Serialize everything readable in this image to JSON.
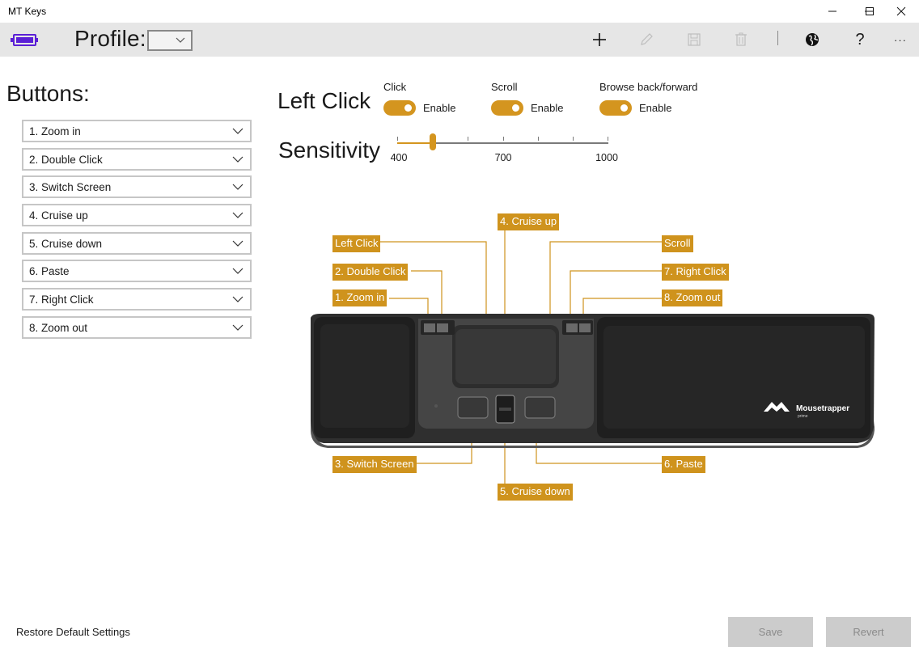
{
  "window": {
    "title": "MT Keys",
    "minimize_icon": "minimize-icon",
    "maximize_icon": "maximize-icon",
    "close_icon": "close-icon"
  },
  "toolbar": {
    "profile_label": "Profile:",
    "profile_value": "",
    "icons": [
      "add-icon",
      "edit-icon",
      "save-icon",
      "delete-icon",
      "globe-icon",
      "help-icon",
      "more-icon"
    ],
    "help_glyph": "?",
    "more_glyph": "···"
  },
  "colors": {
    "accent": "#d4951f",
    "callout": "#cf931d",
    "battery": "#5b1fd6"
  },
  "buttons_panel": {
    "heading": "Buttons:",
    "items": [
      {
        "label": "1. Zoom in"
      },
      {
        "label": "2. Double Click"
      },
      {
        "label": "3. Switch Screen"
      },
      {
        "label": "4. Cruise up"
      },
      {
        "label": "5. Cruise down"
      },
      {
        "label": "6. Paste"
      },
      {
        "label": "7. Right Click"
      },
      {
        "label": "8. Zoom out"
      }
    ]
  },
  "left_click": {
    "title": "Left Click",
    "toggles": [
      {
        "label": "Click",
        "state_text": "Enable",
        "on": true
      },
      {
        "label": "Scroll",
        "state_text": "Enable",
        "on": true
      },
      {
        "label": "Browse back/forward",
        "state_text": "Enable",
        "on": true
      }
    ]
  },
  "sensitivity": {
    "title": "Sensitivity",
    "min": 400,
    "max": 1000,
    "value": 500,
    "labels": [
      "400",
      "700",
      "1000"
    ]
  },
  "device_callouts": {
    "cruise_up": "4. Cruise up",
    "left_click": "Left Click",
    "double_click": "2. Double Click",
    "zoom_in": "1. Zoom in",
    "scroll": "Scroll",
    "right_click": "7. Right Click",
    "zoom_out": "8. Zoom out",
    "switch_screen": "3. Switch Screen",
    "paste": "6. Paste",
    "cruise_down": "5. Cruise down"
  },
  "device": {
    "brand": "Mousetrapper",
    "model": "prime"
  },
  "footer": {
    "restore_label": "Restore Default Settings",
    "save_label": "Save",
    "revert_label": "Revert"
  }
}
